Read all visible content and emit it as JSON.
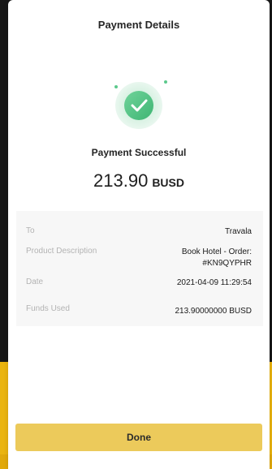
{
  "header": {
    "title": "Payment Details"
  },
  "status": {
    "icon": "check-circle-icon",
    "text": "Payment Successful",
    "accent_color": "#4cbf7f"
  },
  "amount": {
    "value": "213.90",
    "currency": "BUSD"
  },
  "details": [
    {
      "label": "To",
      "value": "Travala"
    },
    {
      "label": "Product Description",
      "value_line1": "Book Hotel - Order:",
      "value_line2": "#KN9QYPHR"
    },
    {
      "label": "Date",
      "value": "2021-04-09 11:29:54"
    },
    {
      "label": "Funds Used",
      "value": "213.90000000 BUSD"
    }
  ],
  "actions": {
    "done_label": "Done",
    "button_color": "#ecca5b"
  }
}
